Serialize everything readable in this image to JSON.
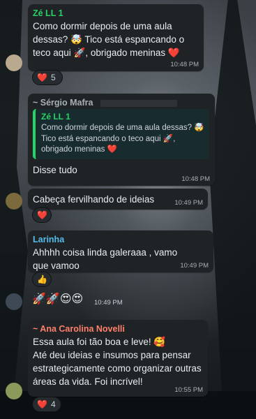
{
  "messages": [
    {
      "sender": "Zé LL 1",
      "sender_color": "#25d366",
      "text": "Como dormir depois de uma aula dessas? 🤯 Tico está espancando o teco aqui 🚀, obrigado meninas ❤️",
      "time": "10:48 PM",
      "reaction": {
        "emoji": "❤️",
        "count": "5"
      }
    },
    {
      "sender": "~ Sérgio Mafra",
      "sender_color": "#a8b0b5",
      "quote_sender": "Zé LL 1",
      "quote_text": "Como dormir depois de uma aula dessas? 🤯\nTico está espancando o teco aqui 🚀, obrigado meninas ❤️",
      "text": "Disse tudo",
      "time": "10:48 PM"
    },
    {
      "text": "Cabeça fervilhando de ideias",
      "time": "10:49 PM",
      "reaction": {
        "emoji": "❤️",
        "count": ""
      }
    },
    {
      "sender": "Larinha",
      "sender_color": "#53bdeb",
      "text": "Ahhhh coisa linda galeraaa , vamo que vamoo",
      "time": "10:49 PM",
      "reaction": {
        "emoji": "👍",
        "count": ""
      }
    },
    {
      "text": "🚀🚀😍😍",
      "time": "10:49 PM"
    },
    {
      "sender": "~ Ana Carolina Novelli",
      "sender_color": "#ff7f6a",
      "text": "Essa aula foi tão boa e leve! 🥰\nAté deu ideias e insumos para pensar estrategicamente como organizar outras áreas da vida. Foi incrível!",
      "time": "10:55 PM",
      "reaction": {
        "emoji": "❤️",
        "count": "4"
      }
    }
  ]
}
